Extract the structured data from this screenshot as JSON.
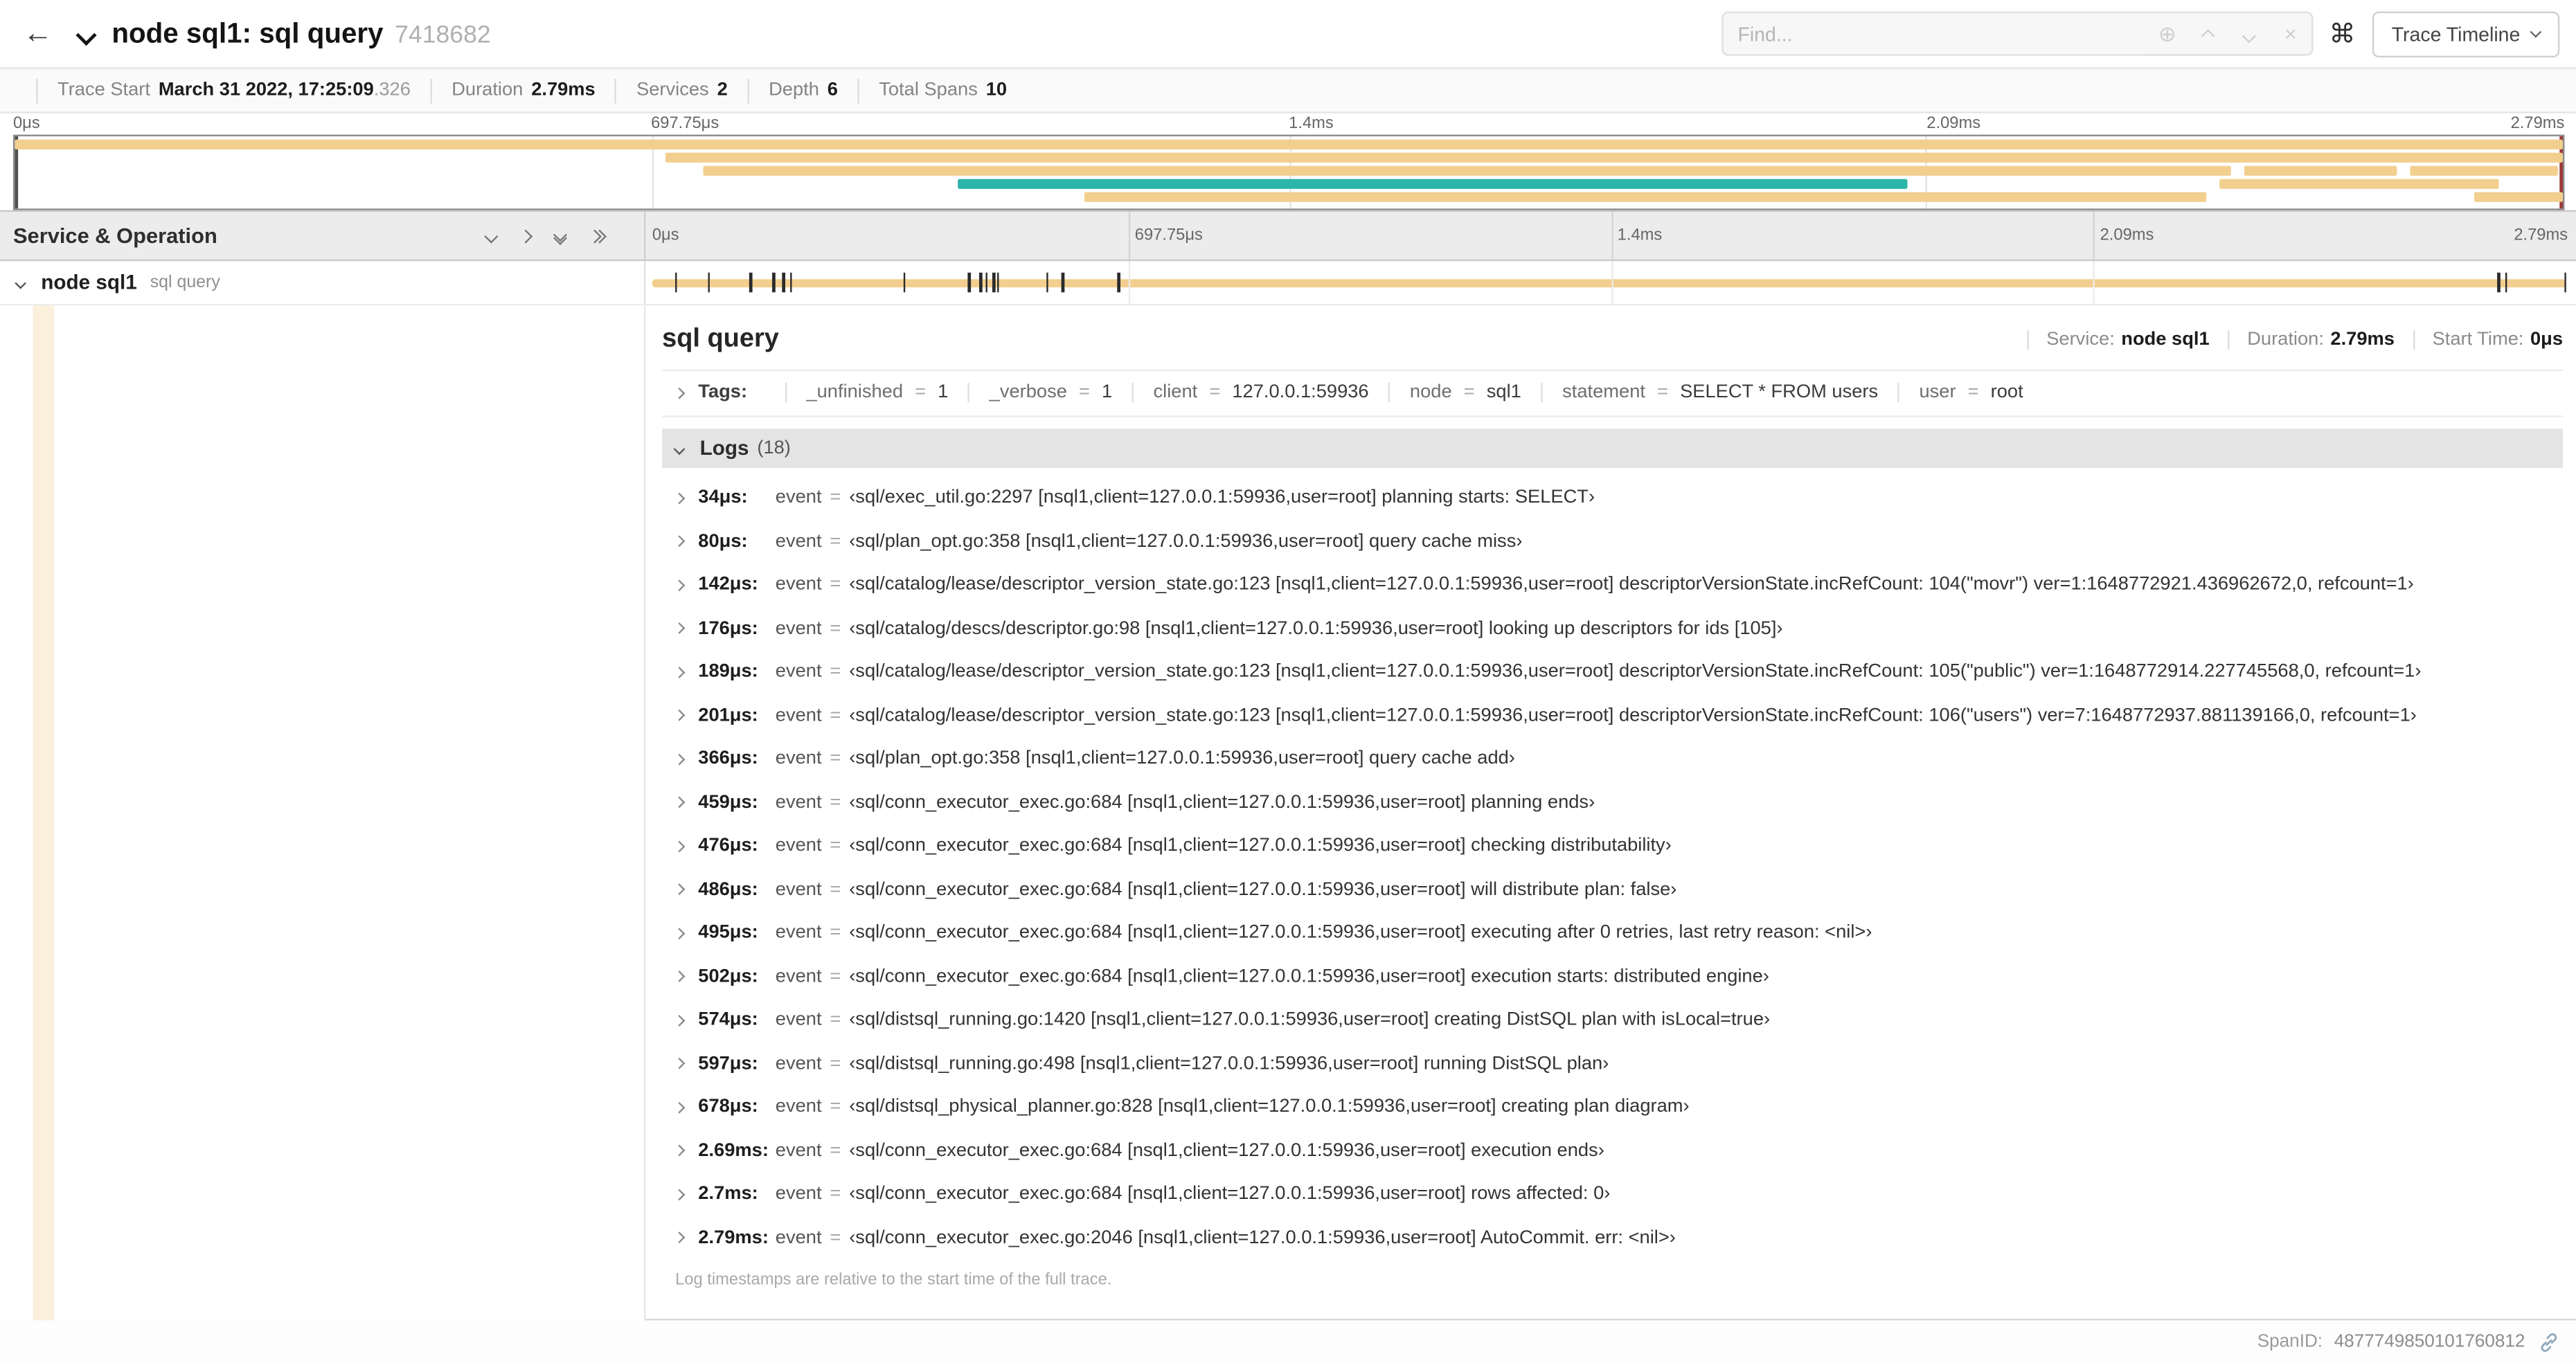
{
  "colors": {
    "tan": "#F2CF8E",
    "teal": "#2CB5A9",
    "cream": "#FAF0DB"
  },
  "eq_sign": "=",
  "time_ticks": [
    "0μs",
    "697.75μs",
    "1.4ms",
    "2.09ms",
    "2.79ms"
  ],
  "header": {
    "back_icon": "←",
    "title": "node sql1: sql query",
    "trace_id": "7418682",
    "find_placeholder": "Find...",
    "focus_icon": "⊕",
    "clear_icon": "×",
    "shortcut_icon": "⌘",
    "view_label": "Trace Timeline"
  },
  "summary": {
    "items": [
      {
        "label": "Trace Start",
        "value": "March 31 2022, 17:25:09",
        "extra": ".326"
      },
      {
        "label": "Duration",
        "value": "2.79ms"
      },
      {
        "label": "Services",
        "value": "2"
      },
      {
        "label": "Depth",
        "value": "6"
      },
      {
        "label": "Total Spans",
        "value": "10"
      }
    ]
  },
  "minimap": {
    "bars": [
      {
        "row": 0,
        "start": 0,
        "width": 100,
        "color": "tan"
      },
      {
        "row": 1,
        "start": 25.5,
        "width": 74.5,
        "color": "tan"
      },
      {
        "row": 2,
        "start": 27,
        "width": 60,
        "color": "tan"
      },
      {
        "row": 3,
        "start": 37,
        "width": 37.3,
        "color": "teal"
      },
      {
        "row": 4,
        "start": 42,
        "width": 44,
        "color": "tan"
      },
      {
        "row": 2,
        "start": 87.5,
        "width": 6,
        "color": "tan"
      },
      {
        "row": 3,
        "start": 86.5,
        "width": 11,
        "color": "tan"
      },
      {
        "row": 2,
        "start": 94,
        "width": 5.8,
        "color": "tan"
      },
      {
        "row": 4,
        "start": 96.5,
        "width": 3.5,
        "color": "tan"
      }
    ]
  },
  "timeline": {
    "left_title": "Service & Operation"
  },
  "span_row": {
    "service": "node sql1",
    "operation": "sql query",
    "log_tick_pcts": [
      1.2,
      2.9,
      5.1,
      6.3,
      6.8,
      7.2,
      13.1,
      16.5,
      17.1,
      17.4,
      17.8,
      18.0,
      20.6,
      21.4,
      24.3,
      96.4,
      96.8,
      99.9
    ]
  },
  "detail": {
    "title": "sql query",
    "meta": [
      {
        "label": "Service:",
        "value": "node sql1"
      },
      {
        "label": "Duration:",
        "value": "2.79ms"
      },
      {
        "label": "Start Time:",
        "value": "0μs"
      }
    ],
    "tags_label": "Tags:",
    "tags": [
      {
        "key": "_unfinished",
        "value": "1"
      },
      {
        "key": "_verbose",
        "value": "1"
      },
      {
        "key": "client",
        "value": "127.0.0.1:59936"
      },
      {
        "key": "node",
        "value": "sql1"
      },
      {
        "key": "statement",
        "value": "SELECT * FROM users"
      },
      {
        "key": "user",
        "value": "root"
      }
    ],
    "logs_label": "Logs",
    "logs_count": "(18)",
    "log_key": "event",
    "logs": [
      {
        "t": "34μs:",
        "v": "‹sql/exec_util.go:2297 [nsql1,client=127.0.0.1:59936,user=root] planning starts: SELECT›"
      },
      {
        "t": "80μs:",
        "v": "‹sql/plan_opt.go:358 [nsql1,client=127.0.0.1:59936,user=root] query cache miss›"
      },
      {
        "t": "142μs:",
        "v": "‹sql/catalog/lease/descriptor_version_state.go:123 [nsql1,client=127.0.0.1:59936,user=root] descriptorVersionState.incRefCount: 104(\"movr\") ver=1:1648772921.436962672,0, refcount=1›"
      },
      {
        "t": "176μs:",
        "v": "‹sql/catalog/descs/descriptor.go:98 [nsql1,client=127.0.0.1:59936,user=root] looking up descriptors for ids [105]›"
      },
      {
        "t": "189μs:",
        "v": "‹sql/catalog/lease/descriptor_version_state.go:123 [nsql1,client=127.0.0.1:59936,user=root] descriptorVersionState.incRefCount: 105(\"public\") ver=1:1648772914.227745568,0, refcount=1›"
      },
      {
        "t": "201μs:",
        "v": "‹sql/catalog/lease/descriptor_version_state.go:123 [nsql1,client=127.0.0.1:59936,user=root] descriptorVersionState.incRefCount: 106(\"users\") ver=7:1648772937.881139166,0, refcount=1›"
      },
      {
        "t": "366μs:",
        "v": "‹sql/plan_opt.go:358 [nsql1,client=127.0.0.1:59936,user=root] query cache add›"
      },
      {
        "t": "459μs:",
        "v": "‹sql/conn_executor_exec.go:684 [nsql1,client=127.0.0.1:59936,user=root] planning ends›"
      },
      {
        "t": "476μs:",
        "v": "‹sql/conn_executor_exec.go:684 [nsql1,client=127.0.0.1:59936,user=root] checking distributability›"
      },
      {
        "t": "486μs:",
        "v": "‹sql/conn_executor_exec.go:684 [nsql1,client=127.0.0.1:59936,user=root] will distribute plan: false›"
      },
      {
        "t": "495μs:",
        "v": "‹sql/conn_executor_exec.go:684 [nsql1,client=127.0.0.1:59936,user=root] executing after 0 retries, last retry reason: <nil>›"
      },
      {
        "t": "502μs:",
        "v": "‹sql/conn_executor_exec.go:684 [nsql1,client=127.0.0.1:59936,user=root] execution starts: distributed engine›"
      },
      {
        "t": "574μs:",
        "v": "‹sql/distsql_running.go:1420 [nsql1,client=127.0.0.1:59936,user=root] creating DistSQL plan with isLocal=true›"
      },
      {
        "t": "597μs:",
        "v": "‹sql/distsql_running.go:498 [nsql1,client=127.0.0.1:59936,user=root] running DistSQL plan›"
      },
      {
        "t": "678μs:",
        "v": "‹sql/distsql_physical_planner.go:828 [nsql1,client=127.0.0.1:59936,user=root] creating plan diagram›"
      },
      {
        "t": "2.69ms:",
        "v": "‹sql/conn_executor_exec.go:684 [nsql1,client=127.0.0.1:59936,user=root] execution ends›"
      },
      {
        "t": "2.7ms:",
        "v": "‹sql/conn_executor_exec.go:684 [nsql1,client=127.0.0.1:59936,user=root] rows affected: 0›"
      },
      {
        "t": "2.79ms:",
        "v": "‹sql/conn_executor_exec.go:2046 [nsql1,client=127.0.0.1:59936,user=root] AutoCommit. err: <nil>›"
      }
    ],
    "footnote": "Log timestamps are relative to the start time of the full trace.",
    "span_id_label": "SpanID:",
    "span_id": "4877749850101760812"
  }
}
